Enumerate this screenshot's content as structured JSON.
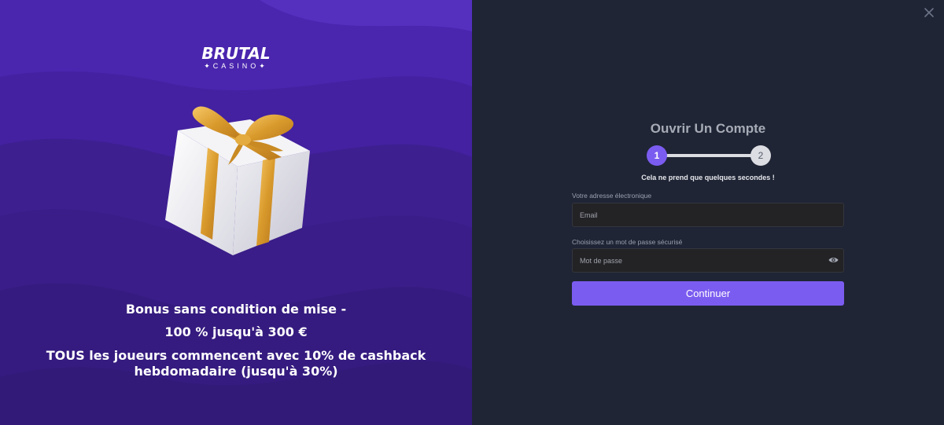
{
  "promo": {
    "logo_main": "BRUTAL",
    "logo_sub": "✦CASINO✦",
    "line1": "Bonus sans condition de mise -",
    "line2": "100 % jusqu'à 300 €",
    "line3": "TOUS les joueurs commencent avec 10% de cashback hebdomadaire (jusqu'à 30%)",
    "image_icon": "gift-box-icon"
  },
  "form": {
    "close_icon": "close-icon",
    "title": "Ouvrir Un Compte",
    "steps": [
      "1",
      "2"
    ],
    "current_step": 1,
    "subtitle": "Cela ne prend que quelques secondes !",
    "email_label": "Votre adresse électronique",
    "email_placeholder": "Email",
    "email_value": "",
    "password_label": "Choisissez un mot de passe sécurisé",
    "password_placeholder": "Mot de passe",
    "password_value": "",
    "password_toggle_icon": "eye-icon",
    "submit_label": "Continuer"
  },
  "colors": {
    "accent": "#7b5cf0",
    "panel_bg": "#1f2535",
    "promo_bg": "#3a1d86"
  }
}
